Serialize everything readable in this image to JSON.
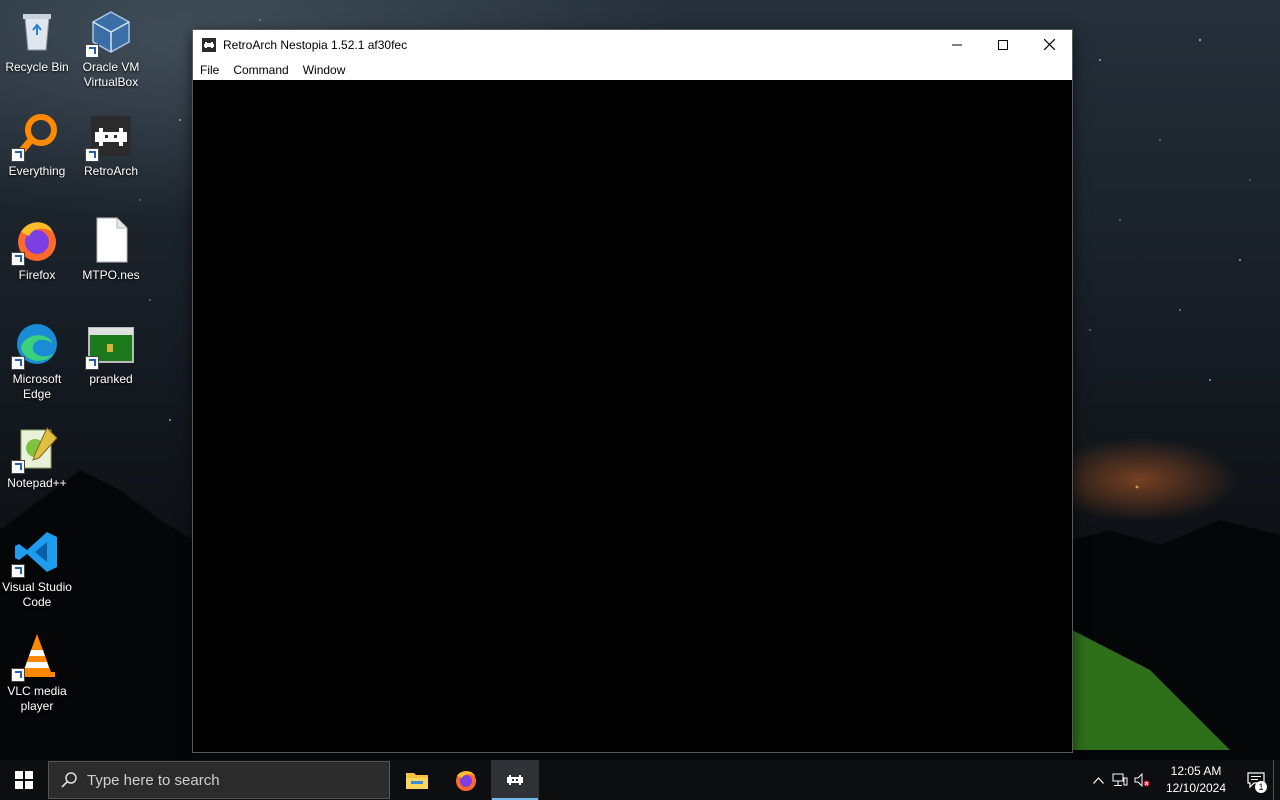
{
  "desktop": {
    "icons": [
      {
        "label": "Recycle Bin",
        "icon": "recycle-bin-icon"
      },
      {
        "label": "Oracle VM VirtualBox",
        "icon": "virtualbox-icon"
      },
      {
        "label": "Everything",
        "icon": "everything-search-icon"
      },
      {
        "label": "RetroArch",
        "icon": "retroarch-icon"
      },
      {
        "label": "Firefox",
        "icon": "firefox-icon"
      },
      {
        "label": "MTPO.nes",
        "icon": "file-icon"
      },
      {
        "label": "Microsoft Edge",
        "icon": "edge-icon"
      },
      {
        "label": "pranked",
        "icon": "pranked-image-icon"
      },
      {
        "label": "Notepad++",
        "icon": "notepad-plus-plus-icon"
      },
      {
        "label": "Visual Studio Code",
        "icon": "vscode-icon"
      },
      {
        "label": "VLC media player",
        "icon": "vlc-icon"
      }
    ]
  },
  "window": {
    "title": "RetroArch Nestopia 1.52.1 af30fec",
    "menu": [
      "File",
      "Command",
      "Window"
    ]
  },
  "taskbar": {
    "search_placeholder": "Type here to search",
    "pinned": [
      "file-explorer-icon",
      "firefox-icon",
      "retroarch-icon"
    ],
    "active_app": "RetroArch",
    "clock": {
      "time": "12:05 AM",
      "date": "12/10/2024"
    },
    "notification_count": "1"
  },
  "colors": {
    "taskbar_bg": "#0d0e10",
    "search_bg": "#2b2b2b",
    "active_indicator": "#76b9ed",
    "window_bg": "#000000"
  }
}
